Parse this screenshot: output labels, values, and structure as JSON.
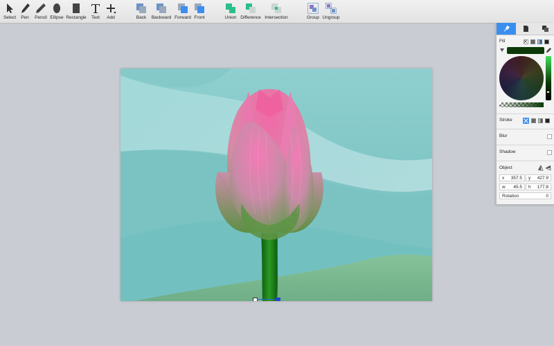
{
  "toolbar": {
    "tools": {
      "select": "Select",
      "pen": "Pen",
      "pencil": "Pencil",
      "ellipse": "Ellipse",
      "rectangle": "Rectangle",
      "text": "Text",
      "add": "Add"
    },
    "arrange": {
      "back": "Back",
      "backward": "Backward",
      "forward": "Forward",
      "front": "Front"
    },
    "boolean": {
      "union": "Union",
      "difference": "Difference",
      "intersection": "Intersection"
    },
    "grouping": {
      "group": "Group",
      "ungroup": "Ungroup"
    }
  },
  "inspector": {
    "fill_label": "Fill",
    "fill_color": "#0c3a08",
    "stroke_label": "Stroke",
    "blur_label": "Blur",
    "shadow_label": "Shadow",
    "object_label": "Object",
    "x_label": "x",
    "x_value": "357.5",
    "y_label": "y",
    "y_value": "427.9",
    "w_label": "w",
    "w_value": "45.5",
    "h_label": "h",
    "h_value": "177.8",
    "rotation_label": "Rotation",
    "rotation_value": "0"
  },
  "colors": {
    "accent": "#3b8ef0",
    "water": "#7cc3c4",
    "petal_pink": "#e87aa8",
    "stem_green": "#1f7a1a"
  }
}
